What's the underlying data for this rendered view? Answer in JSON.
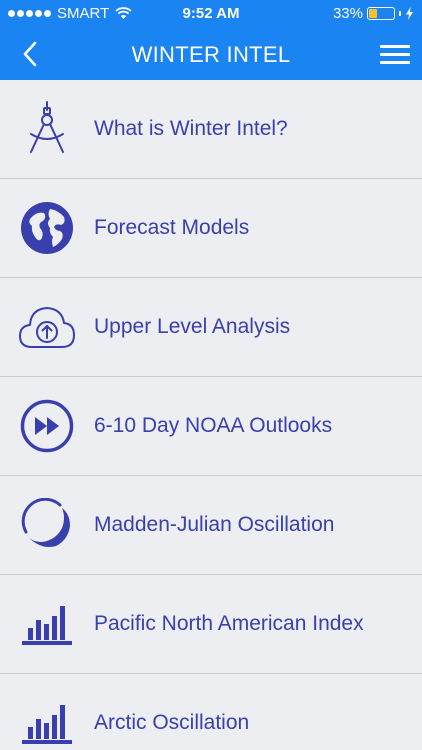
{
  "status_bar": {
    "carrier": "SMART",
    "time": "9:52 AM",
    "battery_percent": "33%",
    "battery_level": 0.33,
    "battery_color": "#f7c22b"
  },
  "nav": {
    "title": "WINTER INTEL",
    "back_icon": "chevron-left-icon",
    "menu_icon": "hamburger-menu-icon"
  },
  "colors": {
    "accent": "#1a84f2",
    "item_text": "#3a3fae",
    "icon": "#3a3fae",
    "background": "#eceef2"
  },
  "menu": {
    "items": [
      {
        "label": "What is Winter Intel?",
        "icon": "compass-drafting-icon"
      },
      {
        "label": "Forecast Models",
        "icon": "globe-icon"
      },
      {
        "label": "Upper Level Analysis",
        "icon": "cloud-upload-icon"
      },
      {
        "label": "6-10 Day NOAA Outlooks",
        "icon": "fast-forward-circle-icon"
      },
      {
        "label": "Madden-Julian Oscillation",
        "icon": "oscillation-arcs-icon"
      },
      {
        "label": "Pacific North American Index",
        "icon": "bar-chart-icon"
      },
      {
        "label": "Arctic Oscillation",
        "icon": "bar-chart-icon"
      }
    ]
  }
}
